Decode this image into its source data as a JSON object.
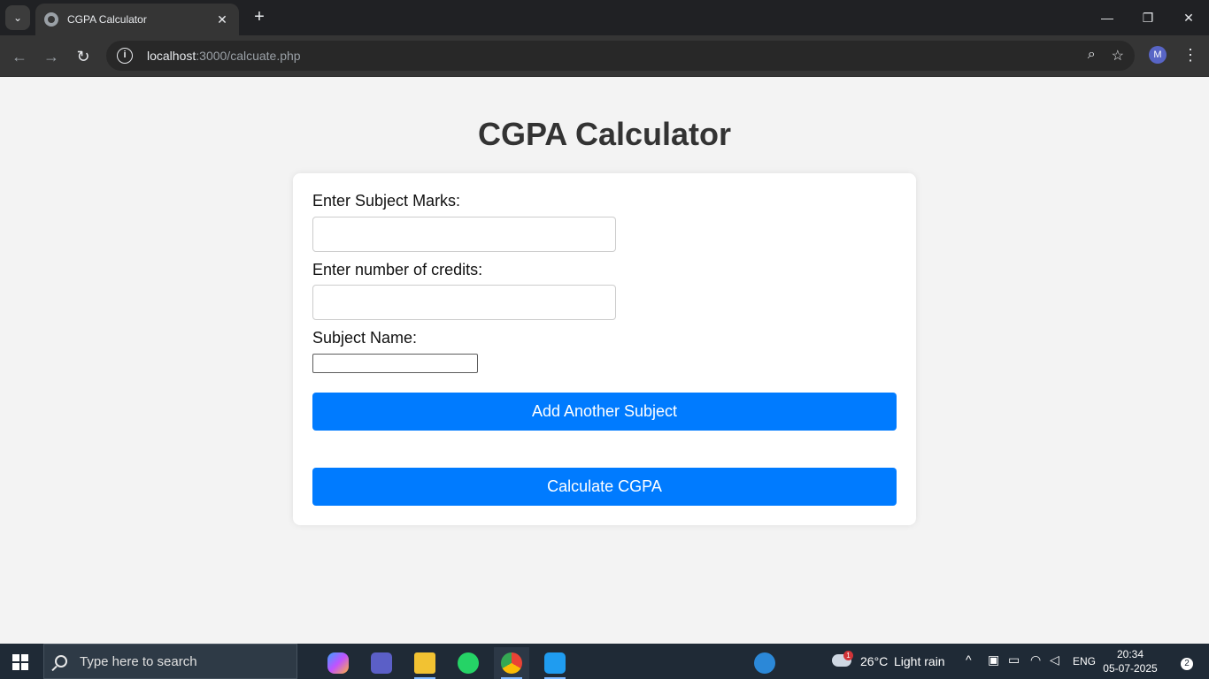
{
  "browser": {
    "tab_title": "CGPA Calculator",
    "url_host": "localhost",
    "url_path": ":3000/calcuate.php",
    "profile_initial": "M"
  },
  "page": {
    "title": "CGPA Calculator",
    "marks_label": "Enter Subject Marks:",
    "marks_value": "",
    "credits_label": "Enter number of credits:",
    "credits_value": "",
    "subject_label": "Subject Name:",
    "subject_value": "",
    "add_button": "Add Another Subject",
    "calculate_button": "Calculate CGPA"
  },
  "taskbar": {
    "search_placeholder": "Type here to search",
    "weather_temp": "26°C",
    "weather_desc": "Light rain",
    "weather_badge": "1",
    "language": "ENG",
    "time": "20:34",
    "date": "05-07-2025",
    "notification_count": "2",
    "apps": [
      "copilot",
      "teams",
      "file-explorer",
      "whatsapp",
      "chrome",
      "vscode"
    ]
  },
  "colors": {
    "accent": "#007bff",
    "page_bg": "#f3f3f3",
    "title_color": "#333333"
  }
}
